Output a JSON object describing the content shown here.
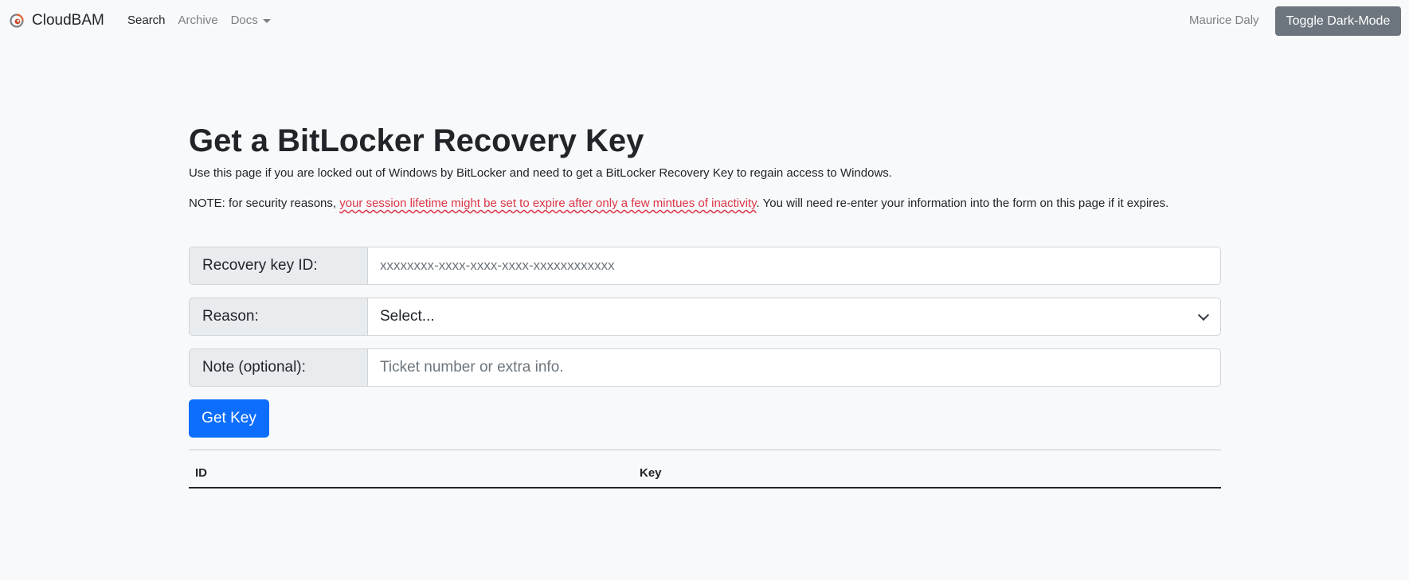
{
  "navbar": {
    "brand": "CloudBAM",
    "links": [
      {
        "label": "Search",
        "active": true
      },
      {
        "label": "Archive",
        "active": false
      },
      {
        "label": "Docs",
        "active": false,
        "dropdown": true
      }
    ],
    "user": "Maurice Daly",
    "toggle_label": "Toggle Dark-Mode"
  },
  "main": {
    "title": "Get a BitLocker Recovery Key",
    "intro": "Use this page if you are locked out of Windows by BitLocker and need to get a BitLocker Recovery Key to regain access to Windows.",
    "note_prefix": "NOTE: for security reasons, ",
    "note_warning": "your session lifetime might be set to expire after only a few mintues of inactivity",
    "note_suffix": ". You will need re-enter your information into the form on this page if it expires."
  },
  "form": {
    "key_id": {
      "label": "Recovery key ID:",
      "placeholder": "xxxxxxxx-xxxx-xxxx-xxxx-xxxxxxxxxxxx"
    },
    "reason": {
      "label": "Reason:",
      "selected": "Select..."
    },
    "note": {
      "label": "Note (optional):",
      "placeholder": "Ticket number or extra info."
    },
    "submit_label": "Get Key"
  },
  "table": {
    "headers": [
      "ID",
      "Key"
    ]
  },
  "colors": {
    "primary": "#0d6efd",
    "secondary": "#6c757d",
    "danger": "#dc3545",
    "background": "#f8f9fa"
  },
  "icons": {
    "brand": "cloudbam-logo-icon",
    "docs_dropdown": "caret-down-icon",
    "select_chevron": "chevron-down-icon"
  }
}
